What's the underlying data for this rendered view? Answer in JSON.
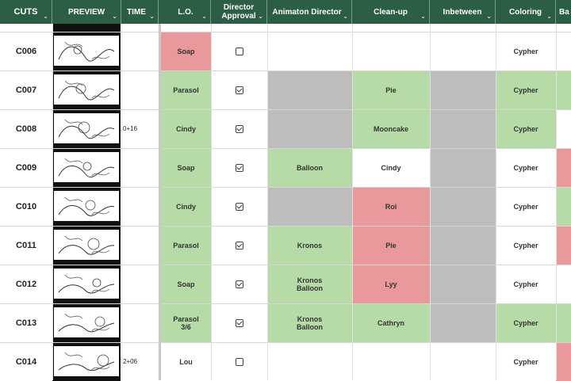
{
  "headers": [
    "CUTS",
    "PREVIEW",
    "TIME",
    "L.O.",
    "Director Approval",
    "Animaton Director",
    "Clean-up",
    "Inbetween",
    "Coloring",
    "Ba"
  ],
  "colors": {
    "header_bg": "#2b5e45",
    "green": "#b7dba6",
    "red": "#e9999b",
    "gray": "#bdbdbd",
    "white": "#ffffff"
  },
  "rows": [
    {
      "cut": "C006",
      "time": "",
      "lo": "Soap",
      "lo_c": "red",
      "checked": false,
      "ad": "",
      "ad_c": "white",
      "cu": "",
      "cu_c": "white",
      "ib_c": "white",
      "col": "Cypher",
      "col_c": "white",
      "ba_c": "white"
    },
    {
      "cut": "C007",
      "time": "",
      "lo": "Parasol",
      "lo_c": "green",
      "checked": true,
      "ad": "",
      "ad_c": "gray",
      "cu": "Pie",
      "cu_c": "green",
      "ib_c": "gray",
      "col": "Cypher",
      "col_c": "green",
      "ba_c": "green"
    },
    {
      "cut": "C008",
      "time": "0+16",
      "lo": "Cindy",
      "lo_c": "green",
      "checked": true,
      "ad": "",
      "ad_c": "gray",
      "cu": "Mooncake",
      "cu_c": "green",
      "ib_c": "gray",
      "col": "Cypher",
      "col_c": "green",
      "ba_c": "white"
    },
    {
      "cut": "C009",
      "time": "",
      "lo": "Soap",
      "lo_c": "green",
      "checked": true,
      "ad": "Balloon",
      "ad_c": "green",
      "cu": "Cindy",
      "cu_c": "white",
      "ib_c": "gray",
      "col": "Cypher",
      "col_c": "white",
      "ba_c": "red"
    },
    {
      "cut": "C010",
      "time": "",
      "lo": "Cindy",
      "lo_c": "green",
      "checked": true,
      "ad": "",
      "ad_c": "gray",
      "cu": "Roi",
      "cu_c": "red",
      "ib_c": "gray",
      "col": "Cypher",
      "col_c": "white",
      "ba_c": "green"
    },
    {
      "cut": "C011",
      "time": "",
      "lo": "Parasol",
      "lo_c": "green",
      "checked": true,
      "ad": "Kronos",
      "ad_c": "green",
      "cu": "Pie",
      "cu_c": "red",
      "ib_c": "gray",
      "col": "Cypher",
      "col_c": "white",
      "ba_c": "red"
    },
    {
      "cut": "C012",
      "time": "",
      "lo": "Soap",
      "lo_c": "green",
      "checked": true,
      "ad": "Kronos\nBalloon",
      "ad_c": "green",
      "cu": "Lyy",
      "cu_c": "red",
      "ib_c": "gray",
      "col": "Cypher",
      "col_c": "white",
      "ba_c": "white"
    },
    {
      "cut": "C013",
      "time": "",
      "lo": "Parasol\n3/6",
      "lo_c": "green",
      "checked": true,
      "ad": "Kronos\nBalloon",
      "ad_c": "green",
      "cu": "Cathryn",
      "cu_c": "green",
      "ib_c": "gray",
      "col": "Cypher",
      "col_c": "green",
      "ba_c": "green"
    },
    {
      "cut": "C014",
      "time": "2+06",
      "lo": "Lou",
      "lo_c": "white",
      "checked": false,
      "ad": "",
      "ad_c": "white",
      "cu": "",
      "cu_c": "white",
      "ib_c": "white",
      "col": "Cypher",
      "col_c": "white",
      "ba_c": "red"
    }
  ]
}
